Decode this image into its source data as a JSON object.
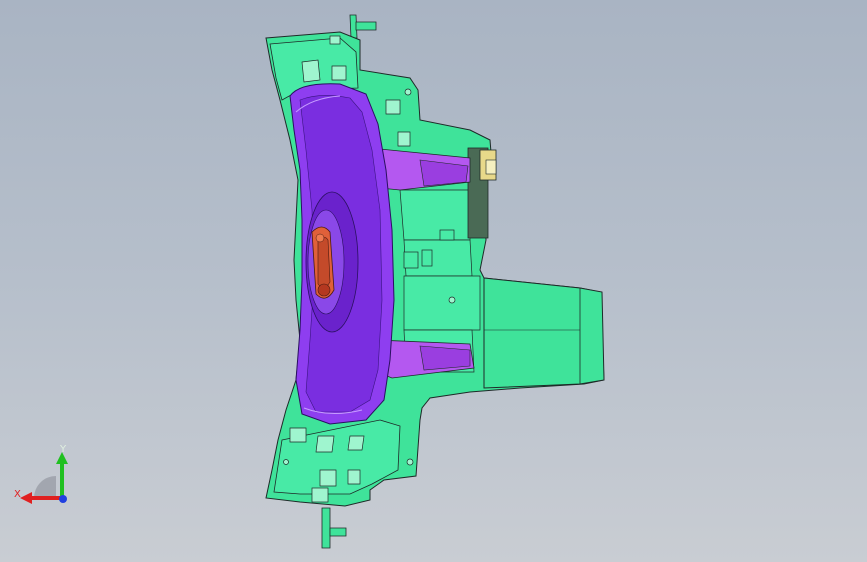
{
  "viewport": {
    "background_top": "#a9b4c3",
    "background_bottom": "#c9cdd3"
  },
  "model": {
    "part_colors": {
      "housing": "#3fe39a",
      "housing_dark": "#27b871",
      "cushion": "#8e3ef0",
      "cushion_dark": "#5a1fa8",
      "core": "#e0603a",
      "edge": "#1e2a28"
    }
  },
  "triad": {
    "x_label": "X",
    "y_label": "Y",
    "x_color": "#e02020",
    "y_color": "#20c020",
    "z_color": "#2040e0"
  }
}
